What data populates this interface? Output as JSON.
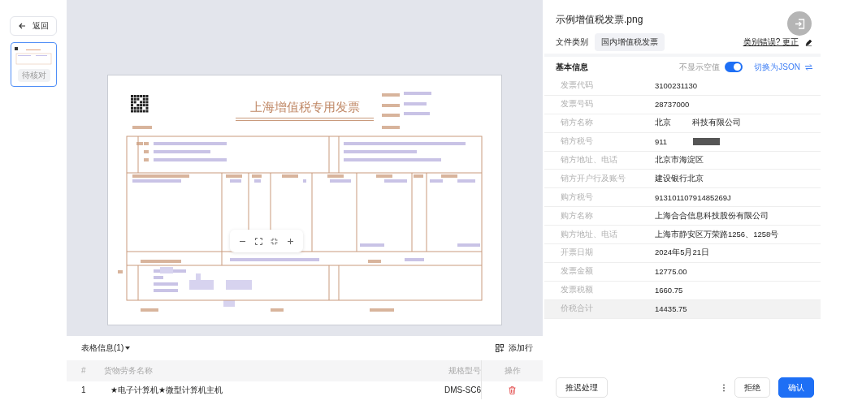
{
  "back_button": {
    "label": "返回"
  },
  "thumbnails": [
    {
      "status": "待核对",
      "selected": true
    }
  ],
  "invoice_image": {
    "title": "上海增值税专用发票"
  },
  "table_panel": {
    "title": "表格信息(1)",
    "add_row": "添加行",
    "columns": [
      "#",
      "货物劳务名称",
      "规格型号",
      "操作"
    ],
    "rows": [
      [
        "1",
        "★电子计算机★微型计算机主机",
        "DMS-SC6"
      ]
    ]
  },
  "detail": {
    "file_name": "示例增值税发票.png",
    "category_label": "文件类别",
    "category": "国内增值税发票",
    "correct_link": "类别错误? 更正",
    "section": "基本信息",
    "hide_empty": {
      "label": "不显示空值",
      "on": true
    },
    "json_toggle": "切换为JSON",
    "fields": [
      {
        "label": "发票代码",
        "value": "3100231130",
        "redacted": false,
        "selected": false
      },
      {
        "label": "发票号码",
        "value": "28737000",
        "redacted": false,
        "selected": false
      },
      {
        "label": "销方名称",
        "value": "北京          科技有限公司",
        "redacted": false,
        "selected": false
      },
      {
        "label": "销方税号",
        "value": "911",
        "redacted": true,
        "selected": false
      },
      {
        "label": "销方地址、电话",
        "value": "北京市海淀区",
        "redacted": false,
        "selected": false
      },
      {
        "label": "销方开户行及账号",
        "value": "建设银行北京",
        "redacted": false,
        "selected": false
      },
      {
        "label": "购方税号",
        "value": "91310110791485269J",
        "redacted": false,
        "selected": false
      },
      {
        "label": "购方名称",
        "value": "上海合合信息科技股份有限公司",
        "redacted": false,
        "selected": false
      },
      {
        "label": "购方地址、电话",
        "value": "上海市静安区万荣路1256、1258号",
        "redacted": false,
        "selected": false
      },
      {
        "label": "开票日期",
        "value": "2024年5月21日",
        "redacted": false,
        "selected": false
      },
      {
        "label": "发票金额",
        "value": "12775.00",
        "redacted": false,
        "selected": false
      },
      {
        "label": "发票税额",
        "value": "1660.75",
        "redacted": false,
        "selected": false
      },
      {
        "label": "价税合计",
        "value": "14435.75",
        "redacted": false,
        "selected": true
      }
    ]
  },
  "actions": {
    "defer": "推迟处理",
    "reject": "拒绝",
    "confirm": "确认"
  }
}
